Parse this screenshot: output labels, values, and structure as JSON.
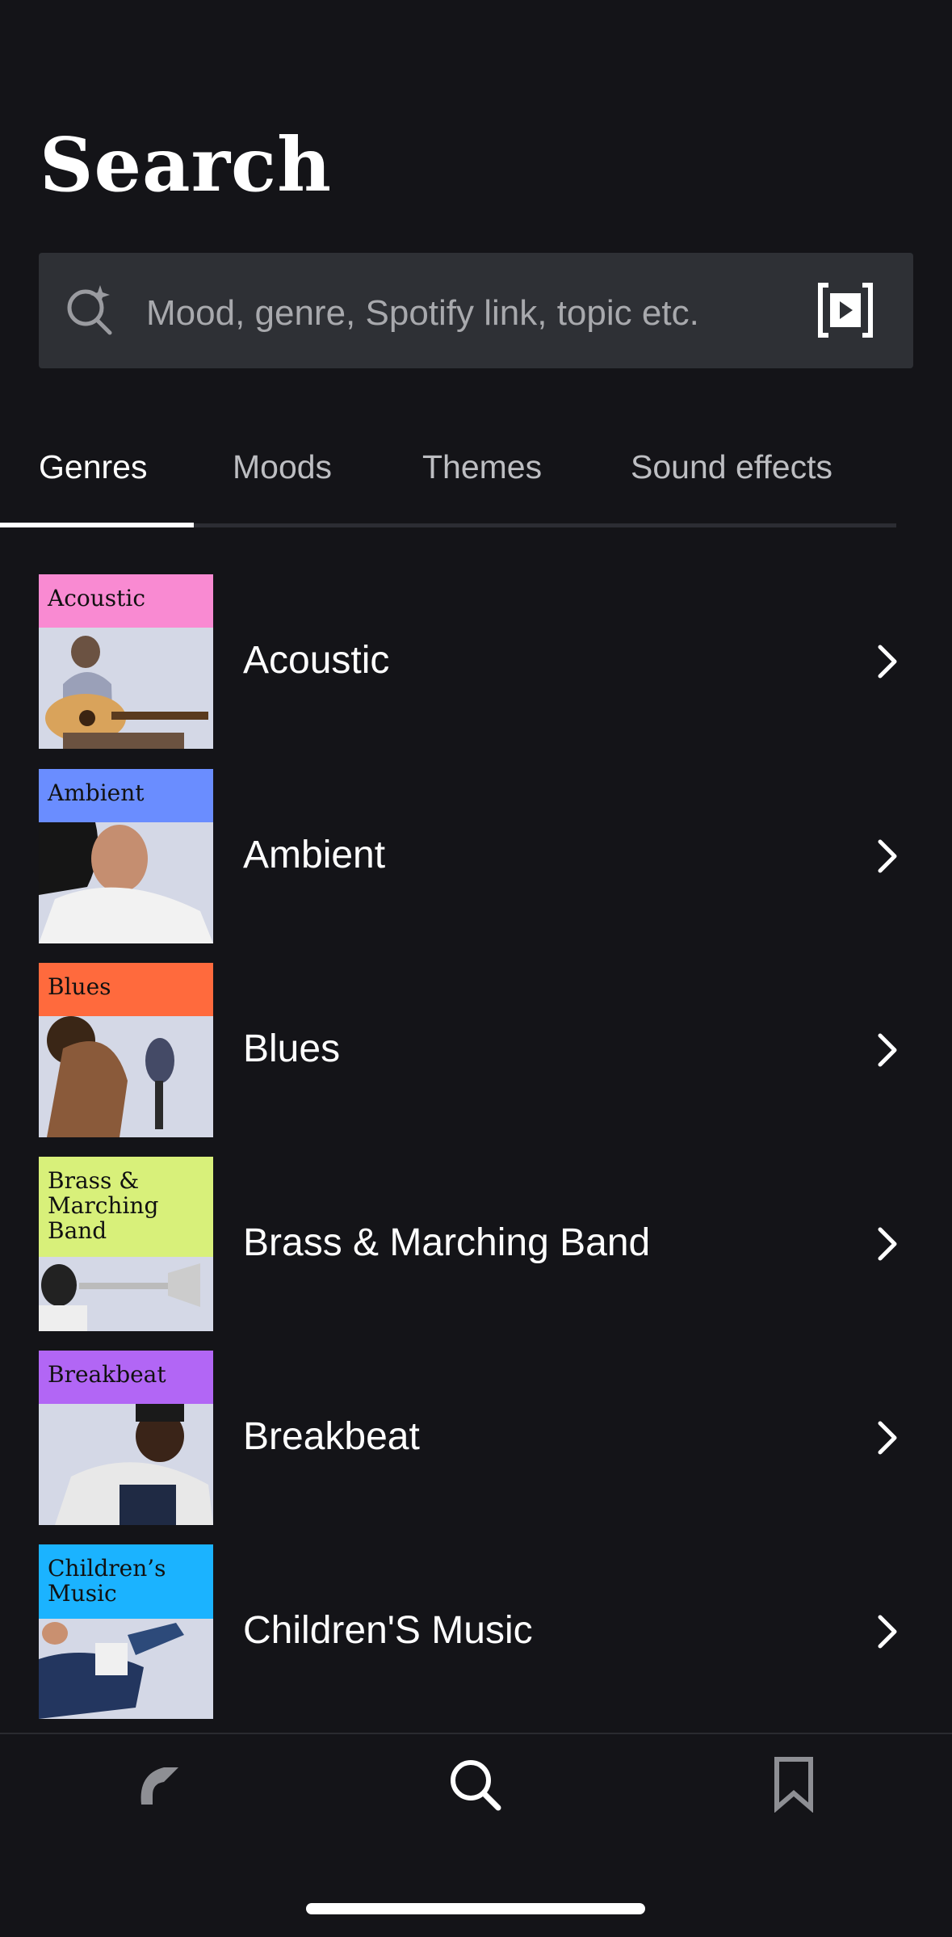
{
  "page": {
    "title": "Search"
  },
  "search": {
    "placeholder": "Mood, genre, Spotify link, topic etc."
  },
  "tabs": [
    {
      "label": "Genres",
      "active": true
    },
    {
      "label": "Moods",
      "active": false
    },
    {
      "label": "Themes",
      "active": false
    },
    {
      "label": "Sound effects",
      "active": false
    }
  ],
  "genres": [
    {
      "label": "Acoustic",
      "thumb_title": "Acoustic",
      "color": "#f98ad2"
    },
    {
      "label": "Ambient",
      "thumb_title": "Ambient",
      "color": "#6a8dff"
    },
    {
      "label": "Blues",
      "thumb_title": "Blues",
      "color": "#ff6a3d"
    },
    {
      "label": "Brass & Marching Band",
      "thumb_title": "Brass & Marching Band",
      "color": "#d8f07a"
    },
    {
      "label": "Breakbeat",
      "thumb_title": "Breakbeat",
      "color": "#b266f5"
    },
    {
      "label": "Children'S Music",
      "thumb_title": "Children’s Music",
      "color": "#1bb3ff"
    }
  ],
  "bottom_nav": [
    {
      "icon": "discover-icon",
      "active": false
    },
    {
      "icon": "search-icon",
      "active": true
    },
    {
      "icon": "bookmark-icon",
      "active": false
    }
  ],
  "colors": {
    "background": "#141418",
    "search_field": "#2e3035",
    "text_secondary": "#bdbec2"
  }
}
